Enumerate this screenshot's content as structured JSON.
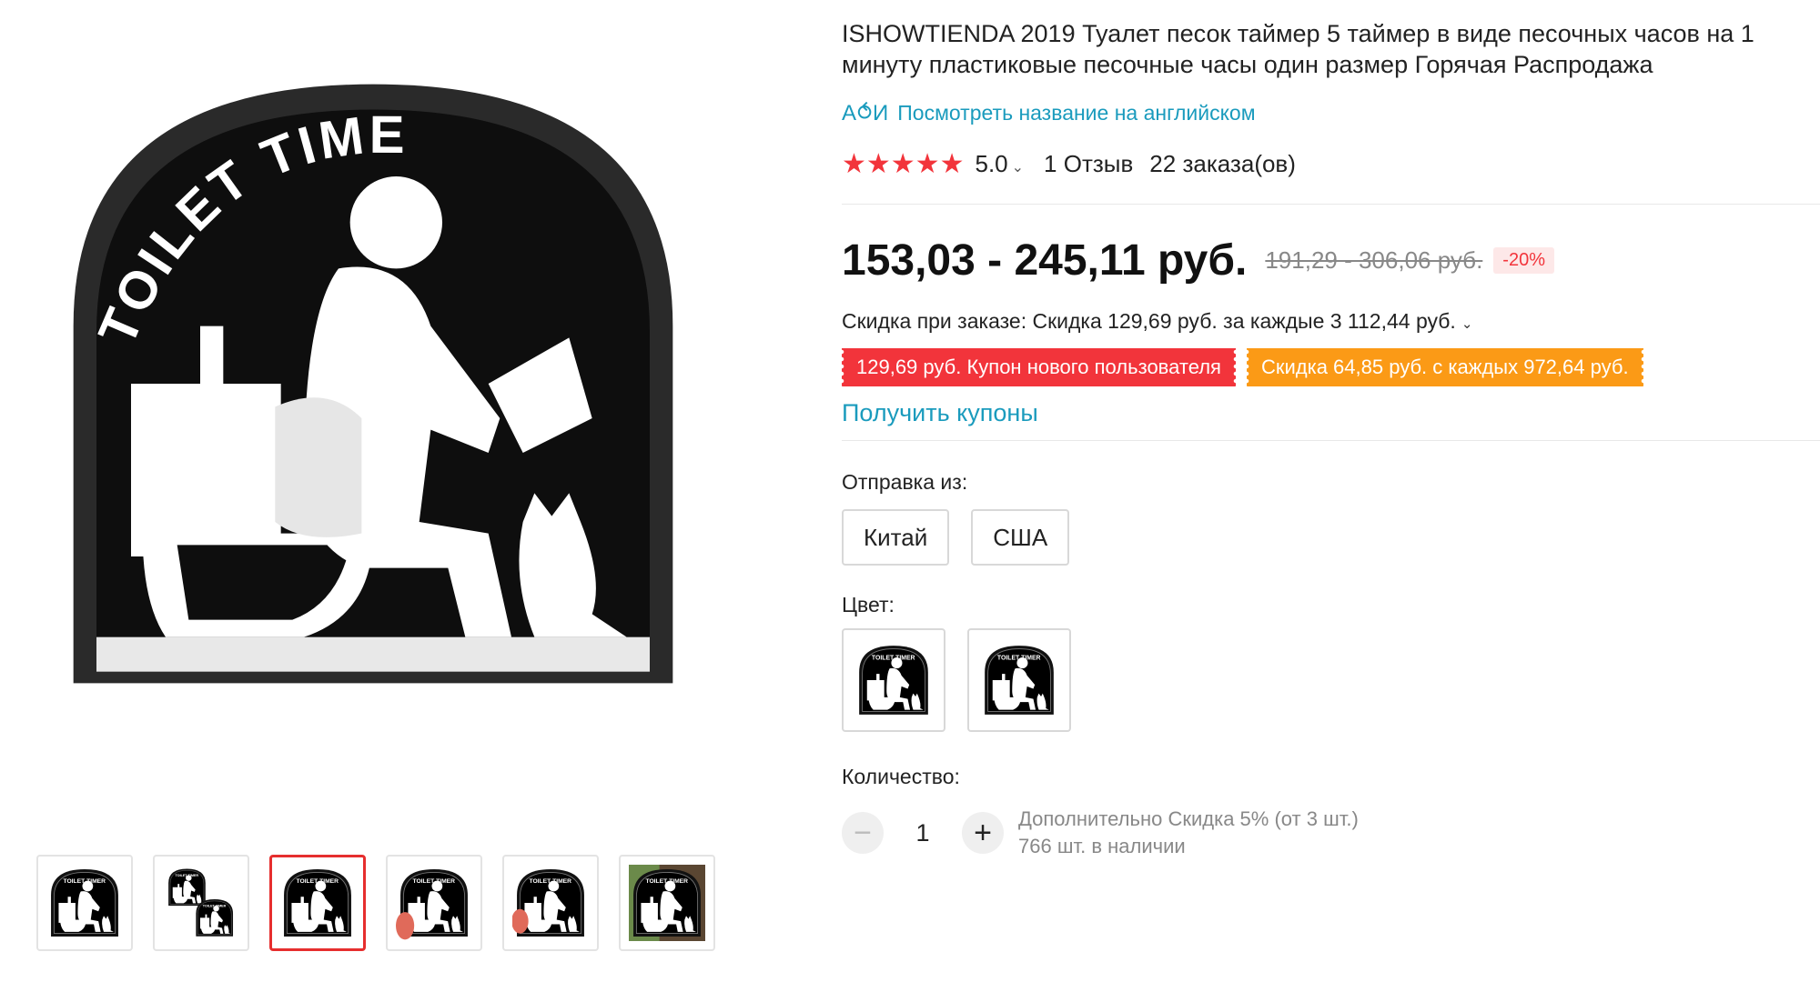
{
  "product": {
    "title": "ISHOWTIENDA 2019 Туалет песок таймер 5 таймер в виде песочных часов на 1 минуту пластиковые песочные часы один размер Горячая Распродажа",
    "translate_icon": "A ⥀ И",
    "translate_link": "Посмотреть название на английском",
    "rating": "5.0",
    "stars": "★★★★★",
    "reviews": "1 Отзыв",
    "orders": "22 заказа(ов)"
  },
  "pricing": {
    "price": "153,03 - 245,11 руб.",
    "old_price": "191,29 - 306,06 руб.",
    "discount": "-20%",
    "order_discount": "Скидка при заказе: Скидка 129,69 руб. за каждые 3 112,44 руб.",
    "coupons": [
      {
        "label": "129,69 руб. Купон нового пользователя",
        "color": "#f2343b"
      },
      {
        "label": "Скидка 64,85 руб. с каждых 972,64 руб.",
        "color": "#fb9a16"
      }
    ],
    "get_coupons": "Получить купоны"
  },
  "shipping": {
    "label": "Отправка из:",
    "options": [
      "Китай",
      "США"
    ]
  },
  "color": {
    "label": "Цвет:"
  },
  "quantity": {
    "label": "Количество:",
    "minus": "−",
    "value": "1",
    "plus": "+",
    "extra_discount": "Дополнительно Скидка 5% (от 3 шт.)",
    "stock": "766 шт. в наличии"
  },
  "gallery": {
    "image_text": "TOILET TIMER"
  },
  "colors": {
    "accent": "#f2343b",
    "link": "#1a9bbd",
    "coupon_orange": "#fb9a16"
  }
}
